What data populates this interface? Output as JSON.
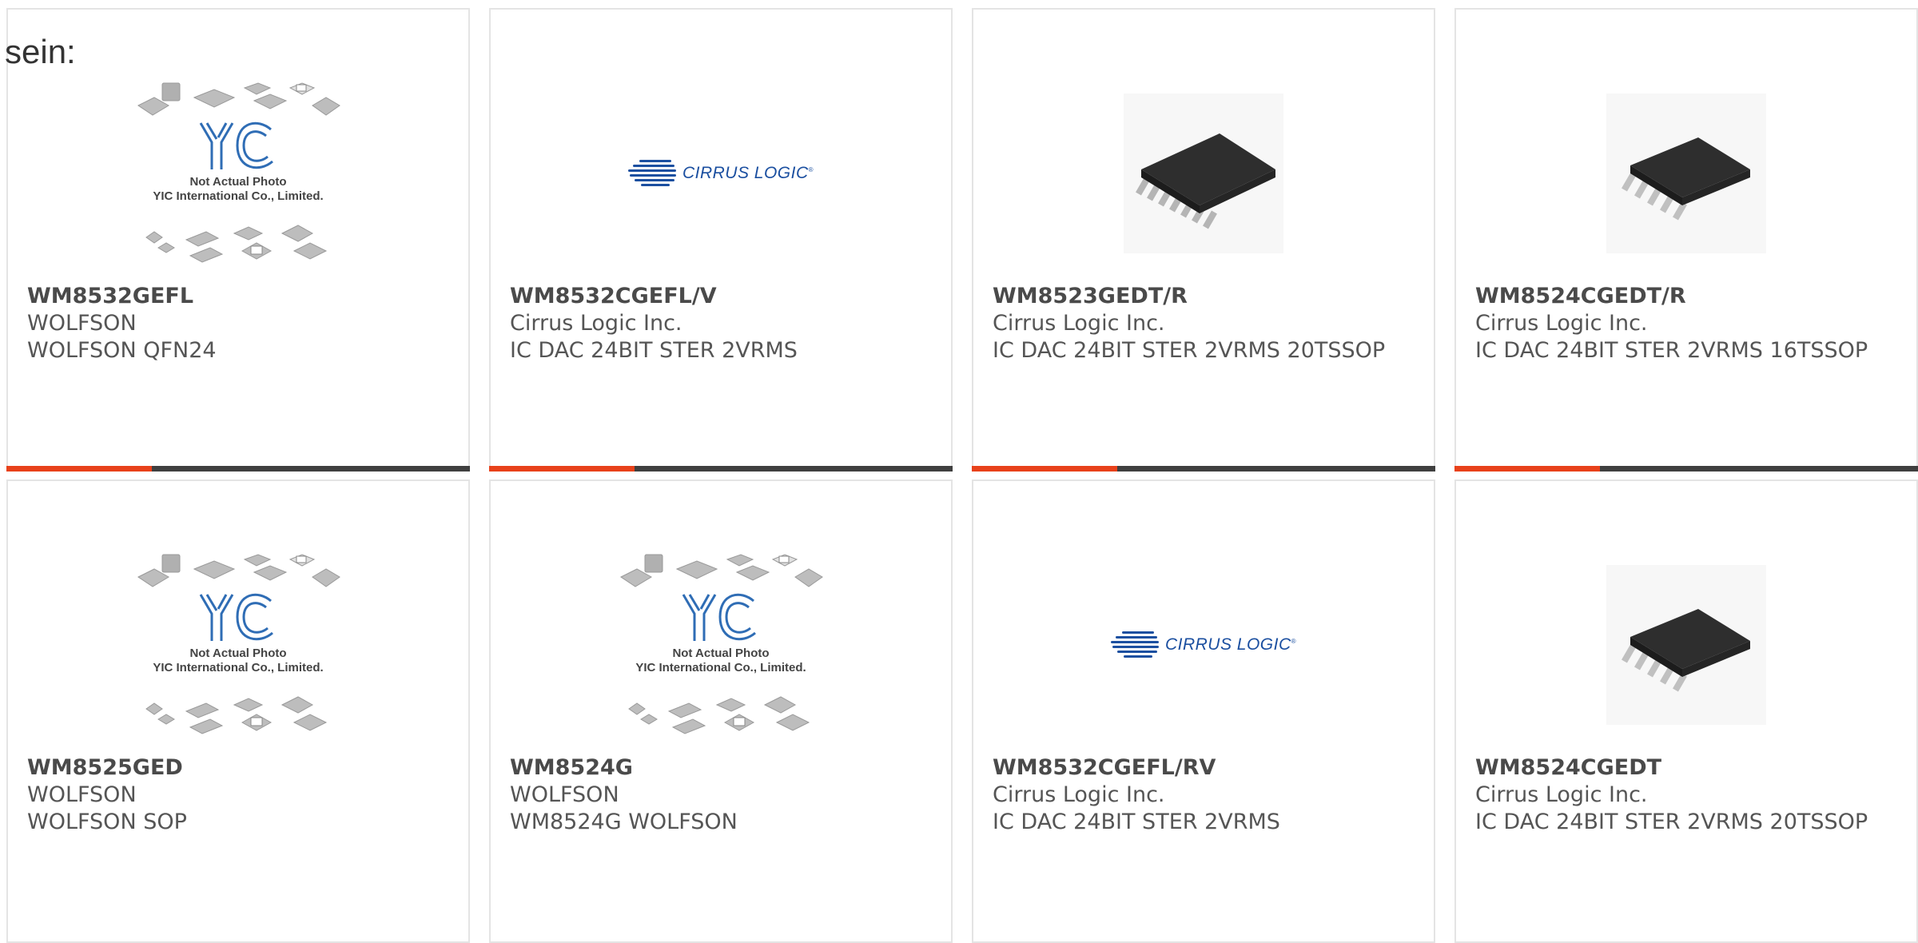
{
  "intro": {
    "text": "sein:"
  },
  "placeholder": {
    "line1": "Not Actual Photo",
    "line2": "YIC International Co., Limited.",
    "logo": "YIC"
  },
  "cirrus_logo": {
    "text": "CIRRUS LOGIC",
    "mark": "®"
  },
  "colors": {
    "accent": "#e8411a",
    "bar": "#3f3f3f",
    "brand_blue": "#1b4fa0"
  },
  "products": [
    {
      "part": "WM8532GEFL",
      "mfr": "WOLFSON",
      "desc": "WOLFSON QFN24",
      "image": "yic-placeholder"
    },
    {
      "part": "WM8532CGEFL/V",
      "mfr": "Cirrus Logic Inc.",
      "desc": "IC DAC 24BIT STER 2VRMS",
      "image": "cirrus-logic-logo"
    },
    {
      "part": "WM8523GEDT/R",
      "mfr": "Cirrus Logic Inc.",
      "desc": "IC DAC 24BIT STER 2VRMS 20TSSOP",
      "image": "tssop-20-chip"
    },
    {
      "part": "WM8524CGEDT/R",
      "mfr": "Cirrus Logic Inc.",
      "desc": "IC DAC 24BIT STER 2VRMS 16TSSOP",
      "image": "tssop-16-chip"
    },
    {
      "part": "WM8525GED",
      "mfr": "WOLFSON",
      "desc": "WOLFSON SOP",
      "image": "yic-placeholder"
    },
    {
      "part": "WM8524G",
      "mfr": "WOLFSON",
      "desc": "WM8524G WOLFSON",
      "image": "yic-placeholder"
    },
    {
      "part": "WM8532CGEFL/RV",
      "mfr": "Cirrus Logic Inc.",
      "desc": "IC DAC 24BIT STER 2VRMS",
      "image": "cirrus-logic-logo"
    },
    {
      "part": "WM8524CGEDT",
      "mfr": "Cirrus Logic Inc.",
      "desc": "IC DAC 24BIT STER 2VRMS 20TSSOP",
      "image": "tssop-16-chip"
    }
  ]
}
